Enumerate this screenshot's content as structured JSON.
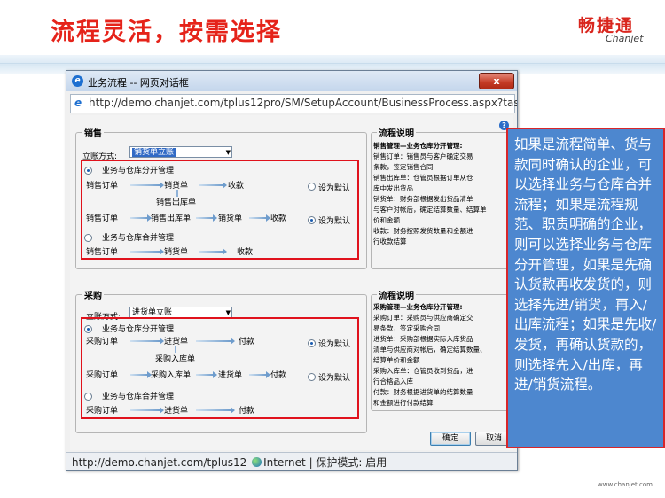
{
  "slide": {
    "title": "流程灵活，按需选择",
    "brand_zh": "畅捷通",
    "brand_en": "Chanjet",
    "footer_url": "www.chanjet.com"
  },
  "window": {
    "title": "业务流程 -- 网页对话框",
    "close_label": "x",
    "url": "http://demo.chanjet.com/tplus12pro/SM/SetupAccount/BusinessProcess.aspx?taskI",
    "help_label": "?",
    "status_url": "http://demo.chanjet.com/tplus12",
    "status_zone": "Internet",
    "status_mode": "| 保护模式: 启用"
  },
  "sales": {
    "legend": "销售",
    "method_label": "立账方式:",
    "method_value": "销货单立账",
    "opt1": "业务与仓库分开管理",
    "opt2": "业务与仓库合并管理",
    "flow1": [
      "销售订单",
      "销货单",
      "收款"
    ],
    "flow1_mid": "销售出库单",
    "flow2": [
      "销售订单",
      "销售出库单",
      "销货单",
      "收款"
    ],
    "flow3": [
      "销售订单",
      "销货单",
      "收款"
    ],
    "default1": "设为默认",
    "default2": "设为默认"
  },
  "purchase": {
    "legend": "采购",
    "method_label": "立账方式:",
    "method_value": "进货单立账",
    "opt1": "业务与仓库分开管理",
    "opt2": "业务与仓库合并管理",
    "flow1": [
      "采购订单",
      "进货单",
      "付款"
    ],
    "flow1_mid": "采购入库单",
    "flow2": [
      "采购订单",
      "采购入库单",
      "进货单",
      "付款"
    ],
    "flow3": [
      "采购订单",
      "进货单",
      "付款"
    ],
    "default1": "设为默认",
    "default2": "设为默认"
  },
  "sales_desc": {
    "legend": "流程说明",
    "heading": "销售管理—业务仓库分开管理:",
    "lines": [
      "销售订单：销售员与客户确定交易",
      "条款，签定销售合同",
      "销售出库单：仓管员根据订单从仓",
      "库中发出货品",
      "销货单：财务部根据发出货品清单",
      "与客户对帐后，确定结算数量、结算单",
      "价和金额",
      "收款：财务按照发货数量和金额进",
      "行收款结算"
    ]
  },
  "purchase_desc": {
    "legend": "流程说明",
    "heading": "采购管理—业务仓库分开管理:",
    "lines": [
      "采购订单：采购员与供应商确定交",
      "易条款，签定采购合同",
      "进货单：采购部根据实际入库货品",
      "清单与供应商对帐后，确定结算数量、",
      "结算单价和金额",
      "采购入库单：仓管员收到货品，进",
      "行合格品入库",
      "付款：财务根据进货单的结算数量",
      "和金额进行付款结算"
    ]
  },
  "buttons": {
    "ok": "确定",
    "cancel": "取消"
  },
  "callout": {
    "text": "如果是流程简单、货与款同时确认的企业，可以选择业务与仓库合并流程；如果是流程规范、职责明确的企业，则可以选择业务与仓库分开管理，如果是先确认货款再收发货的，则选择先进/销货，再入/出库流程；如果是先收/发货，再确认货款的，则选择先入/出库，再进/销货流程。"
  }
}
